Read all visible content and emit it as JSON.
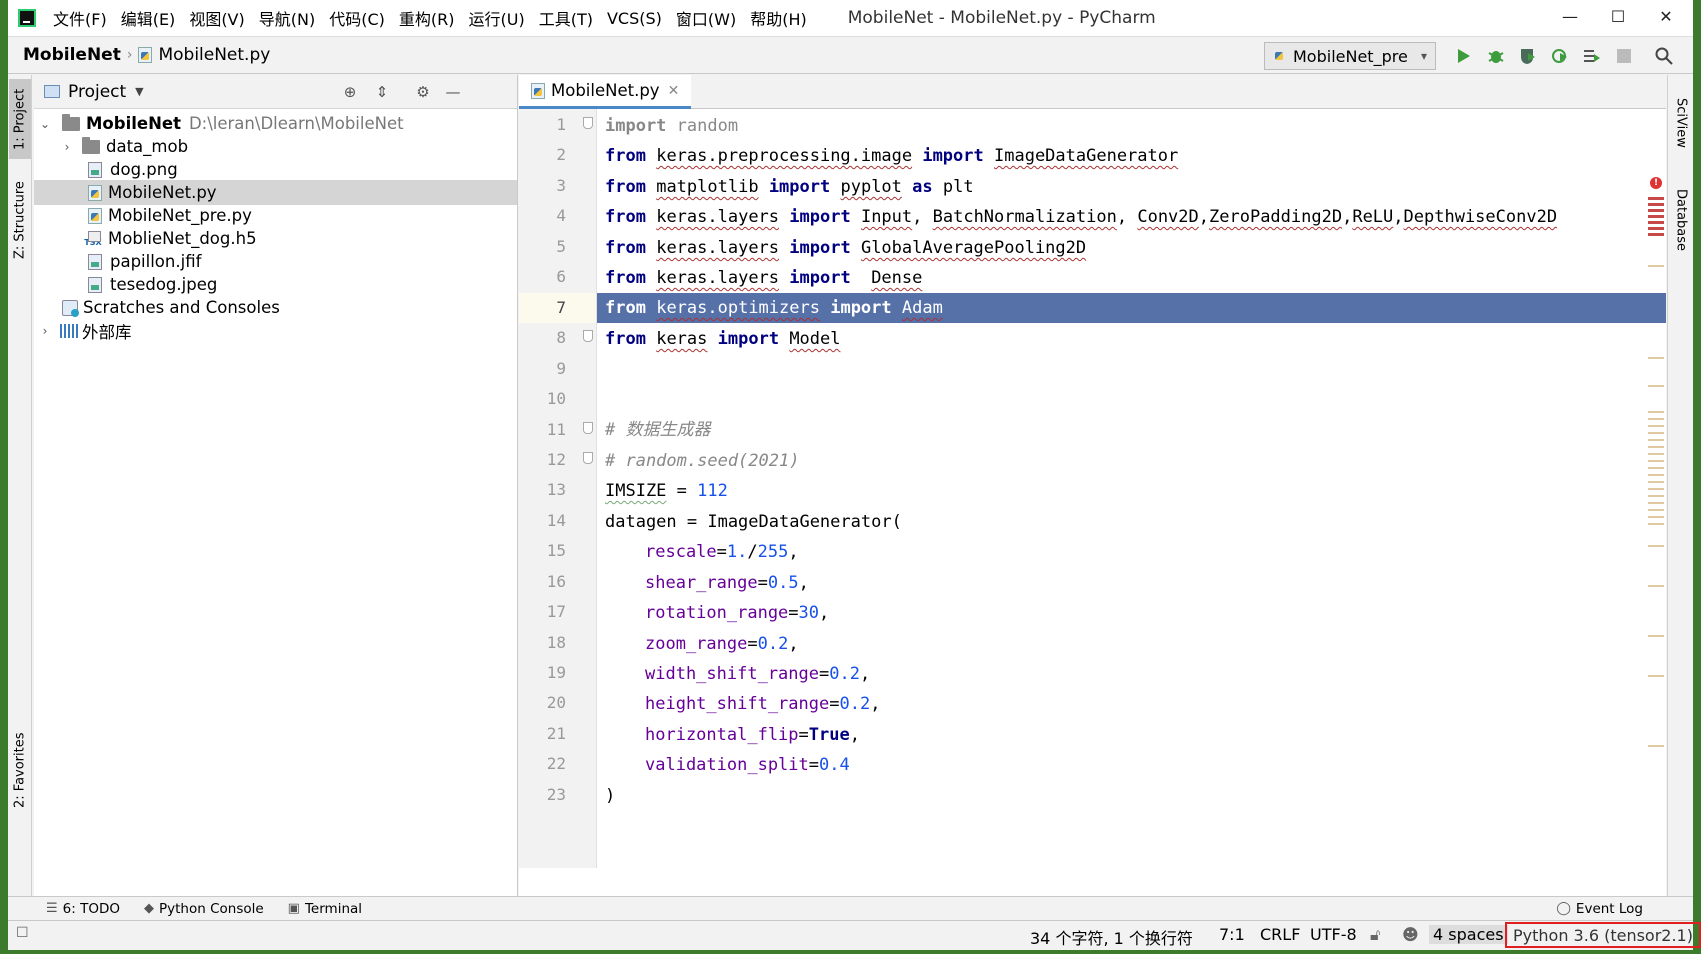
{
  "menu": [
    "文件(F)",
    "编辑(E)",
    "视图(V)",
    "导航(N)",
    "代码(C)",
    "重构(R)",
    "运行(U)",
    "工具(T)",
    "VCS(S)",
    "窗口(W)",
    "帮助(H)"
  ],
  "window_title": "MobileNet - MobileNet.py - PyCharm",
  "window_controls": {
    "minimize": "—",
    "maximize": "☐",
    "close": "✕"
  },
  "breadcrumb": {
    "project": "MobileNet",
    "file": "MobileNet.py"
  },
  "run_config": "MobileNet_pre",
  "left_tabs": {
    "project": "1: Project",
    "structure": "Z: Structure",
    "favorites": "2: Favorites"
  },
  "right_tabs": {
    "sciview": "SciView",
    "database": "Database"
  },
  "project_panel": {
    "title": "Project",
    "tree": [
      {
        "label": "MobileNet",
        "path": "D:\\leran\\Dlearn\\MobileNet"
      },
      {
        "label": "data_mob"
      },
      {
        "label": "dog.png"
      },
      {
        "label": "MobileNet.py"
      },
      {
        "label": "MobileNet_pre.py"
      },
      {
        "label": "MoblieNet_dog.h5"
      },
      {
        "label": "papillon.jfif"
      },
      {
        "label": "tesedog.jpeg"
      },
      {
        "label": "Scratches and Consoles"
      },
      {
        "label": "外部库"
      }
    ]
  },
  "editor": {
    "tab": "MobileNet.py",
    "line_numbers": [
      "1",
      "2",
      "3",
      "4",
      "5",
      "6",
      "7",
      "8",
      "9",
      "10",
      "11",
      "12",
      "13",
      "14",
      "15",
      "16",
      "17",
      "18",
      "19",
      "20",
      "21",
      "22",
      "23"
    ],
    "current_line": "7",
    "code": {
      "l1": {
        "k": "import",
        "r": " random"
      },
      "l2": {
        "k1": "from",
        "m": "keras.preprocessing.image",
        "k2": "import",
        "n": "ImageDataGenerator"
      },
      "l3": {
        "k1": "from",
        "m": "matplotlib",
        "k2": "import",
        "n": "pyplot",
        "k3": "as",
        "r": "plt"
      },
      "l4": {
        "k1": "from",
        "m": "keras.layers",
        "k2": "import",
        "n1": "Input",
        "n2": "BatchNormalization",
        "n3": "Conv2D",
        "n4": "ZeroPadding2D",
        "n5": "ReLU",
        "n6": "DepthwiseConv2D"
      },
      "l5": {
        "k1": "from",
        "m": "keras.layers",
        "k2": "import",
        "n": "GlobalAveragePooling2D"
      },
      "l6": {
        "k1": "from",
        "m": "keras.layers",
        "k2": "import",
        "n": "Dense"
      },
      "l7": {
        "k1": "from",
        "m": "keras.optimizers",
        "k2": "import",
        "n": "Adam"
      },
      "l8": {
        "k1": "from",
        "m": "keras",
        "k2": "import",
        "n": "Model"
      },
      "l11": "# 数据生成器",
      "l12": "# random.seed(2021)",
      "l13": {
        "v": "IMSIZE",
        "op": " = ",
        "n": "112"
      },
      "l14": "datagen = ImageDataGenerator(",
      "params": [
        {
          "p": "rescale",
          "v": "1.",
          "s": "/",
          "v2": "255"
        },
        {
          "p": "shear_range",
          "v": "0.5"
        },
        {
          "p": "rotation_range",
          "v": "30"
        },
        {
          "p": "zoom_range",
          "v": "0.2"
        },
        {
          "p": "width_shift_range",
          "v": "0.2"
        },
        {
          "p": "height_shift_range",
          "v": "0.2"
        },
        {
          "p": "horizontal_flip",
          "v": "True"
        },
        {
          "p": "validation_split",
          "v": "0.4"
        }
      ],
      "l23": ")"
    }
  },
  "bottom_tools": {
    "todo": "6: TODO",
    "console": "Python Console",
    "terminal": "Terminal",
    "eventlog": "Event Log"
  },
  "status": {
    "chars": "34 个字符, 1 个换行符",
    "pos": "7:1",
    "eol": "CRLF",
    "enc": "UTF-8",
    "indent": "4 spaces",
    "interpreter": "Python 3.6 (tensor2.1)"
  }
}
